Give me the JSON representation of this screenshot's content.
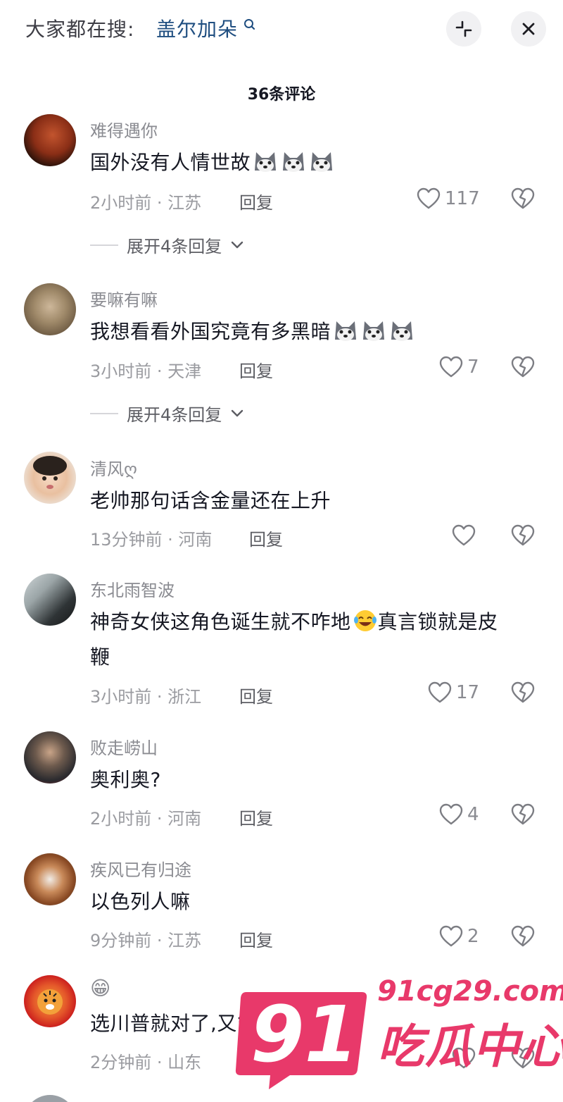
{
  "search": {
    "prefix": "大家都在搜:",
    "term": "盖尔加朵"
  },
  "header": {
    "count": "36条评论"
  },
  "reply_label": "回复",
  "comments": [
    {
      "user": "难得遇你",
      "text": "国外没有人情世故",
      "emoji": [
        "husky-emoji",
        "husky-emoji",
        "husky-emoji"
      ],
      "time": "2小时前 · 江苏",
      "likes": "117",
      "expand": "展开4条回复"
    },
    {
      "user": "要嘛有嘛",
      "text": "我想看看外国究竟有多黑暗",
      "emoji": [
        "husky-emoji",
        "husky-emoji",
        "husky-emoji"
      ],
      "time": "3小时前 · 天津",
      "likes": "7",
      "expand": "展开4条回复"
    },
    {
      "user": "清风ღ",
      "text": "老帅那句话含金量还在上升",
      "time": "13分钟前 · 河南",
      "likes": ""
    },
    {
      "user": "东北雨智波",
      "text_line1": "神奇女侠这角色诞生就不咋地",
      "text_line1_end": "真言锁就是皮",
      "text_line2": "鞭",
      "emoji": [
        "laughing-crying-emoji"
      ],
      "time": "3小时前 · 浙江",
      "likes": "17"
    },
    {
      "user": "败走崂山",
      "text": "奥利奥?",
      "time": "2小时前 · 河南",
      "likes": "4"
    },
    {
      "user": "疾风已有归途",
      "text": "以色列人嘛",
      "time": "9分钟前 · 江苏",
      "likes": "2"
    },
    {
      "user": "😁",
      "text": "选川普就对了,又能学外语了",
      "time": "2分钟前 · 山东",
      "likes": ""
    }
  ],
  "watermark": {
    "number": "91",
    "domain": "91cg29.com",
    "title": "吃瓜中心"
  },
  "colors": {
    "accent": "#1f4e80",
    "watermark": "#e8396a",
    "muted": "#8a8b91"
  }
}
